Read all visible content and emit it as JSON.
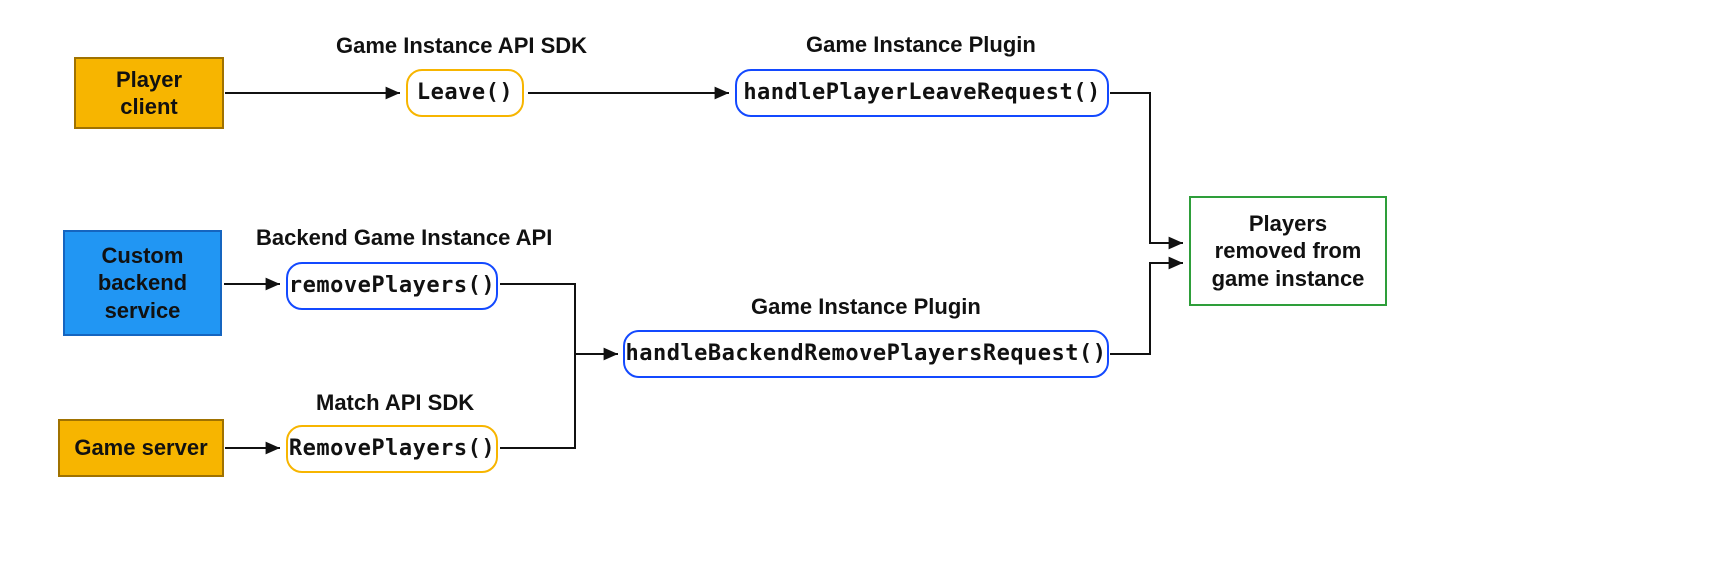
{
  "actors": {
    "player_client": "Player client",
    "custom_backend": "Custom backend service",
    "game_server": "Game server"
  },
  "section_labels": {
    "sdk_top": "Game Instance API SDK",
    "plugin_top": "Game Instance Plugin",
    "backend_api": "Backend Game Instance API",
    "match_sdk": "Match API SDK",
    "plugin_bottom": "Game Instance Plugin"
  },
  "calls": {
    "leave": "Leave()",
    "removePlayers_backend": "removePlayers()",
    "removePlayers_match": "RemovePlayers()",
    "handlePlayerLeave": "handlePlayerLeaveRequest()",
    "handleBackendRemove": "handleBackendRemovePlayersRequest()"
  },
  "result": "Players removed from game instance"
}
